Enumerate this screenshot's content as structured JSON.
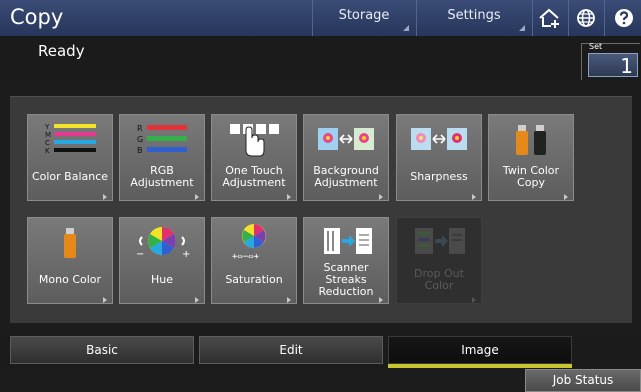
{
  "header": {
    "title": "Copy",
    "storage_label": "Storage",
    "settings_label": "Settings",
    "home_icon": "home-add-icon",
    "globe_icon": "globe-icon",
    "help_icon": "help-icon"
  },
  "status": {
    "text": "Ready",
    "set_label": "Set",
    "set_value": "1"
  },
  "tiles": [
    {
      "label": "Color Balance",
      "icon": "color-balance-icon",
      "enabled": true
    },
    {
      "label": "RGB Adjustment",
      "icon": "rgb-adjustment-icon",
      "enabled": true
    },
    {
      "label": "One Touch Adjustment",
      "icon": "one-touch-icon",
      "enabled": true
    },
    {
      "label": "Background Adjustment",
      "icon": "background-adjustment-icon",
      "enabled": true
    },
    {
      "label": "Sharpness",
      "icon": "sharpness-icon",
      "enabled": true
    },
    {
      "label": "Twin Color Copy",
      "icon": "twin-color-icon",
      "enabled": true
    },
    {
      "label": "Mono Color",
      "icon": "mono-color-icon",
      "enabled": true
    },
    {
      "label": "Hue",
      "icon": "hue-icon",
      "enabled": true
    },
    {
      "label": "Saturation",
      "icon": "saturation-icon",
      "enabled": true
    },
    {
      "label": "Scanner Streaks Reduction",
      "icon": "scanner-streaks-icon",
      "enabled": true
    },
    {
      "label": "Drop Out Color",
      "icon": "drop-out-color-icon",
      "enabled": false
    }
  ],
  "tabs": {
    "basic": "Basic",
    "edit": "Edit",
    "image": "Image",
    "active": "Image"
  },
  "footer": {
    "job_status": "Job Status"
  },
  "colors": {
    "header_blue": "#2f4068",
    "accent_yellow": "#c9c52e"
  }
}
